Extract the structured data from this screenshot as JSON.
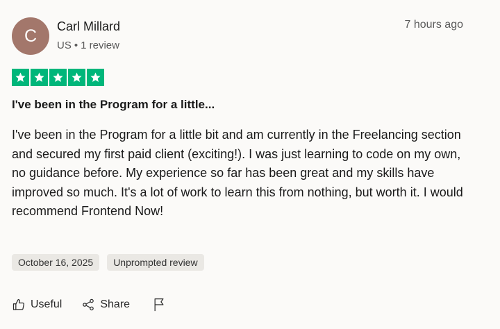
{
  "review": {
    "author": {
      "initial": "C",
      "name": "Carl Millard",
      "country": "US",
      "separator": "•",
      "review_count": "1 review",
      "avatar_color": "#a3776b"
    },
    "time_ago": "7 hours ago",
    "rating": {
      "stars": 5,
      "max": 5,
      "color": "#00b67a"
    },
    "title": "I've been in the Program for a little...",
    "body": "I've been in the Program for a little bit and am currently in the Freelancing section and secured my first paid client (exciting!). I was just learning to code on my own, no guidance before. My experience so far has been great and my skills have improved so much. It's a lot of work to learn this from nothing, but worth it. I would recommend Frontend Now!",
    "date_badge": "October 16, 2025",
    "type_badge": "Unprompted review"
  },
  "actions": {
    "useful_label": "Useful",
    "useful_icon": "thumbs-up-icon",
    "share_label": "Share",
    "share_icon": "share-icon",
    "report_icon": "flag-icon"
  }
}
